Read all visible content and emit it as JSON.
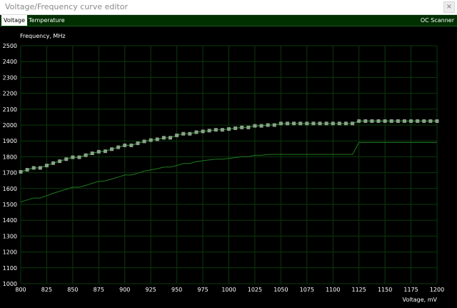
{
  "window": {
    "title": "Voltage/Frequency curve editor",
    "close_label": "×"
  },
  "tabs": {
    "voltage": "Voltage",
    "temperature": "Temperature",
    "oc_scanner": "OC Scanner"
  },
  "colors": {
    "background": "#000000",
    "grid": "#0a3a0a",
    "curve_line": "#2a8a2a",
    "curve_point": "#8ca08c",
    "baseline": "#1f7a1f",
    "text": "#ffffff"
  },
  "chart_data": {
    "type": "line",
    "ylabel": "Frequency, MHz",
    "xlabel": "Voltage, mV",
    "xlim": [
      800,
      1200
    ],
    "ylim": [
      1000,
      2500
    ],
    "x_ticks": [
      800,
      825,
      850,
      875,
      900,
      925,
      950,
      975,
      1000,
      1025,
      1050,
      1075,
      1100,
      1125,
      1150,
      1175,
      1200
    ],
    "y_ticks": [
      1000,
      1100,
      1200,
      1300,
      1400,
      1500,
      1600,
      1700,
      1800,
      1900,
      2000,
      2100,
      2200,
      2300,
      2400,
      2500
    ],
    "grid": true,
    "series": [
      {
        "role": "curve",
        "markers": true,
        "x": [
          800,
          806.25,
          812.5,
          818.75,
          825,
          831.25,
          837.5,
          843.75,
          850,
          856.25,
          862.5,
          868.75,
          875,
          881.25,
          887.5,
          893.75,
          900,
          906.25,
          912.5,
          918.75,
          925,
          931.25,
          937.5,
          943.75,
          950,
          956.25,
          962.5,
          968.75,
          975,
          981.25,
          987.5,
          993.75,
          1000,
          1006.25,
          1012.5,
          1018.75,
          1025,
          1031.25,
          1037.5,
          1043.75,
          1050,
          1056.25,
          1062.5,
          1068.75,
          1075,
          1081.25,
          1087.5,
          1093.75,
          1100,
          1106.25,
          1112.5,
          1118.75,
          1125,
          1131.25,
          1137.5,
          1143.75,
          1150,
          1156.25,
          1162.5,
          1168.75,
          1175,
          1181.25,
          1187.5,
          1193.75,
          1200
        ],
        "y": [
          1705,
          1718,
          1730,
          1730,
          1745,
          1760,
          1772,
          1785,
          1797,
          1797,
          1810,
          1822,
          1832,
          1835,
          1848,
          1860,
          1872,
          1872,
          1885,
          1897,
          1905,
          1910,
          1920,
          1920,
          1935,
          1945,
          1945,
          1955,
          1960,
          1965,
          1970,
          1970,
          1975,
          1980,
          1985,
          1985,
          1995,
          1995,
          2000,
          2000,
          2010,
          2010,
          2010,
          2010,
          2010,
          2010,
          2010,
          2010,
          2010,
          2010,
          2010,
          2010,
          2025,
          2025,
          2025,
          2025,
          2025,
          2025,
          2025,
          2025,
          2025,
          2025,
          2025,
          2025,
          2025
        ]
      },
      {
        "role": "baseline",
        "markers": false,
        "x": [
          800,
          806.25,
          812.5,
          818.75,
          825,
          831.25,
          837.5,
          843.75,
          850,
          856.25,
          862.5,
          868.75,
          875,
          881.25,
          887.5,
          893.75,
          900,
          906.25,
          912.5,
          918.75,
          925,
          931.25,
          937.5,
          943.75,
          950,
          956.25,
          962.5,
          968.75,
          975,
          981.25,
          987.5,
          993.75,
          1000,
          1006.25,
          1012.5,
          1018.75,
          1025,
          1031.25,
          1037.5,
          1043.75,
          1050,
          1056.25,
          1062.5,
          1068.75,
          1075,
          1081.25,
          1087.5,
          1093.75,
          1100,
          1106.25,
          1112.5,
          1118.75,
          1125,
          1131.25,
          1137.5,
          1143.75,
          1150,
          1156.25,
          1162.5,
          1168.75,
          1175,
          1181.25,
          1187.5,
          1193.75,
          1200
        ],
        "y": [
          1515,
          1528,
          1540,
          1540,
          1555,
          1570,
          1583,
          1595,
          1608,
          1608,
          1620,
          1633,
          1645,
          1648,
          1660,
          1672,
          1685,
          1685,
          1697,
          1710,
          1718,
          1725,
          1735,
          1735,
          1745,
          1758,
          1758,
          1770,
          1775,
          1780,
          1785,
          1785,
          1790,
          1795,
          1800,
          1800,
          1810,
          1810,
          1815,
          1815,
          1815,
          1815,
          1815,
          1815,
          1815,
          1815,
          1815,
          1815,
          1815,
          1815,
          1815,
          1815,
          1890,
          1890,
          1890,
          1890,
          1890,
          1890,
          1890,
          1890,
          1890,
          1890,
          1890,
          1890,
          1890
        ]
      }
    ]
  }
}
